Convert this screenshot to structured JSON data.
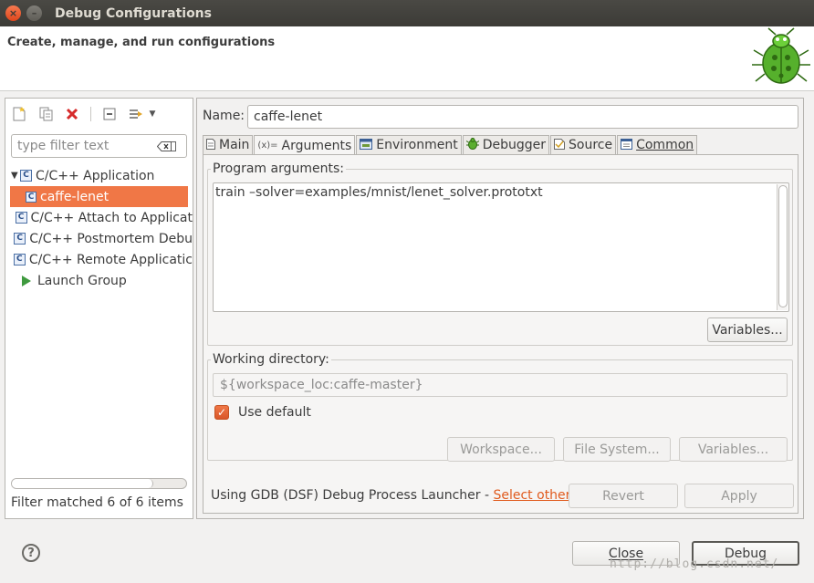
{
  "window": {
    "title": "Debug Configurations",
    "close_glyph": "×",
    "minimize_glyph": "–"
  },
  "header": {
    "subtitle": "Create, manage, and run configurations"
  },
  "left": {
    "filter_placeholder": "type filter text",
    "tree": [
      {
        "label": "C/C++ Application",
        "expanded": true
      },
      {
        "label": "caffe-lenet",
        "selected": true
      },
      {
        "label": "C/C++ Attach to Applicat"
      },
      {
        "label": "C/C++ Postmortem Debu"
      },
      {
        "label": "C/C++ Remote Applicatic"
      },
      {
        "label": "Launch Group"
      }
    ],
    "status": "Filter matched 6 of 6 items",
    "toolbar_icons": [
      "new-config-icon",
      "duplicate-icon",
      "delete-icon",
      "collapse-all-icon",
      "filter-icon",
      "dropdown-icon"
    ]
  },
  "right": {
    "name_label": "Name:",
    "name_value": "caffe-lenet",
    "tabs": [
      {
        "label": "Main",
        "icon": "main-tab-icon"
      },
      {
        "label": "Arguments",
        "icon": "arguments-tab-icon",
        "active": true
      },
      {
        "label": "Environment",
        "icon": "environment-tab-icon"
      },
      {
        "label": "Debugger",
        "icon": "debugger-tab-icon"
      },
      {
        "label": "Source",
        "icon": "source-tab-icon"
      },
      {
        "label": "Common",
        "icon": "common-tab-icon"
      }
    ],
    "program_args_label": "Program arguments:",
    "program_args_value": "train –solver=examples/mnist/lenet_solver.prototxt",
    "variables_label": "Variables...",
    "working_dir_label": "Working directory:",
    "working_dir_value": "${workspace_loc:caffe-master}",
    "use_default_label": "Use default",
    "use_default_checked": true,
    "workspace_label": "Workspace...",
    "file_system_label": "File System...",
    "variables2_label": "Variables...",
    "launcher_text": "Using GDB (DSF) Debug Process Launcher - ",
    "launcher_link": "Select other...",
    "revert_label": "Revert",
    "apply_label": "Apply"
  },
  "footer": {
    "close_label": "Close",
    "debug_label": "Debug",
    "watermark": "http://blog.csdn.net/"
  },
  "colors": {
    "accent": "#f07746",
    "titlebar": "#3c3b37",
    "link": "#e05b1e"
  }
}
